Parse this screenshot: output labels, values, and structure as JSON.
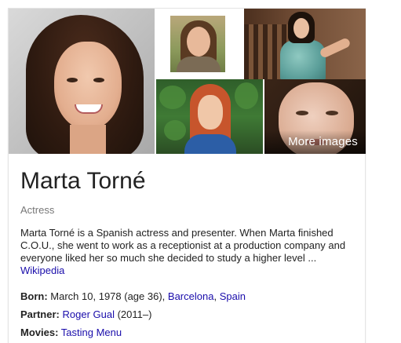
{
  "images": {
    "more_images_label": "More images"
  },
  "person": {
    "name": "Marta Torné",
    "subtitle": "Actress",
    "description": "Marta Torné is a Spanish actress and presenter. When Marta finished C.O.U., she went to work as a receptionist at a production company and everyone liked her so much she decided to study a higher level ...",
    "source": "Wikipedia"
  },
  "facts": {
    "born": {
      "label": "Born:",
      "text": "March 10, 1978 (age 36),",
      "link1": "Barcelona",
      "separator": ",",
      "link2": "Spain"
    },
    "partner": {
      "label": "Partner:",
      "link": "Roger Gual",
      "suffix": "(2011–)"
    },
    "movies": {
      "label": "Movies:",
      "link": "Tasting Menu"
    }
  },
  "colors": {
    "link": "#1a0dab",
    "subtitle": "#777777",
    "text": "#222222"
  }
}
